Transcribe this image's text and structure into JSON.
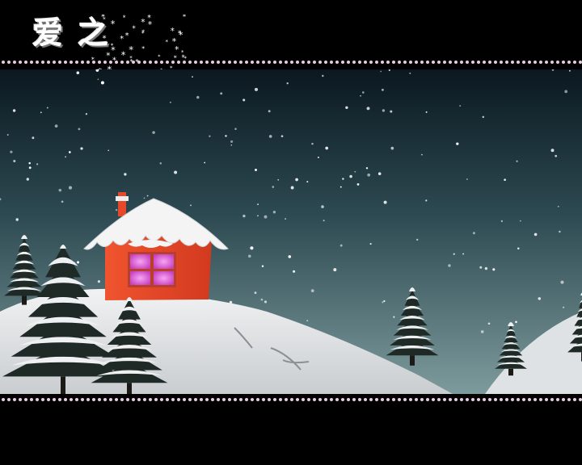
{
  "header": {
    "title": "爱之"
  },
  "colors": {
    "background": "#000000",
    "sky_top": "#0d1b22",
    "sky_bottom": "#6f8f93",
    "house": "#e8482a",
    "window_glow": "#e26ad8",
    "snow": "#e7e9ea",
    "dot_border": "#e9c9e4"
  },
  "icons": {
    "title_sparkle": "snowflake-sparkle-icon"
  }
}
